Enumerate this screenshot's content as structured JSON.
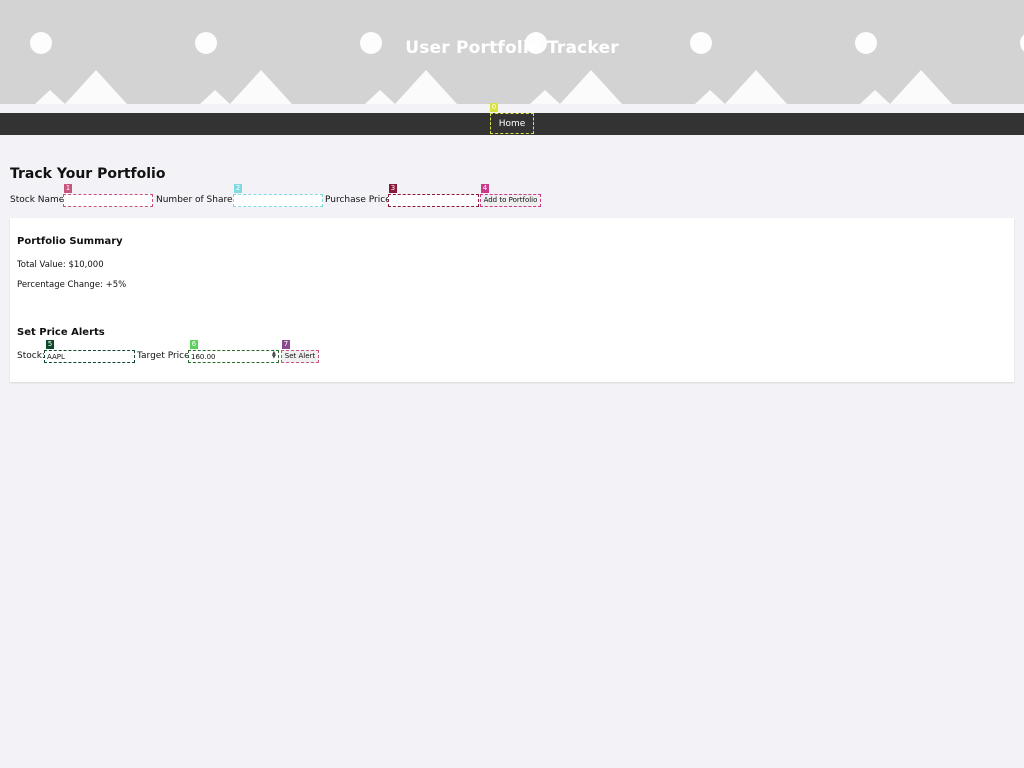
{
  "header": {
    "title": "User Portfolio Tracker"
  },
  "nav": {
    "home_label": "Home"
  },
  "markers": [
    "0",
    "1",
    "2",
    "3",
    "4",
    "5",
    "6",
    "7"
  ],
  "track": {
    "title": "Track Your Portfolio",
    "stock_name_label": "Stock Name:",
    "stock_name_value": "",
    "shares_label": "Number of Shares:",
    "shares_value": "",
    "price_label": "Purchase Price:",
    "price_value": "",
    "add_button": "Add to Portfolio"
  },
  "summary": {
    "title": "Portfolio Summary",
    "total_value": "Total Value: $10,000",
    "percentage_change": "Percentage Change: +5%"
  },
  "alerts": {
    "title": "Set Price Alerts",
    "stock_label": "Stock:",
    "stock_value": "AAPL",
    "target_label": "Target Price:",
    "target_value": "160.00",
    "set_button": "Set Alert"
  },
  "colors": {
    "header_bg": "#d3d3d3",
    "nav_bg": "#333333",
    "page_bg": "#f3f3f7",
    "marker_0": "#d8e23a",
    "marker_1": "#c9557e",
    "marker_2": "#7fdbe0",
    "marker_3": "#8b1a3a",
    "marker_4": "#c93a8a",
    "marker_5": "#0e4a2a",
    "marker_6": "#5ccf5c",
    "marker_7": "#8a4a8f"
  }
}
